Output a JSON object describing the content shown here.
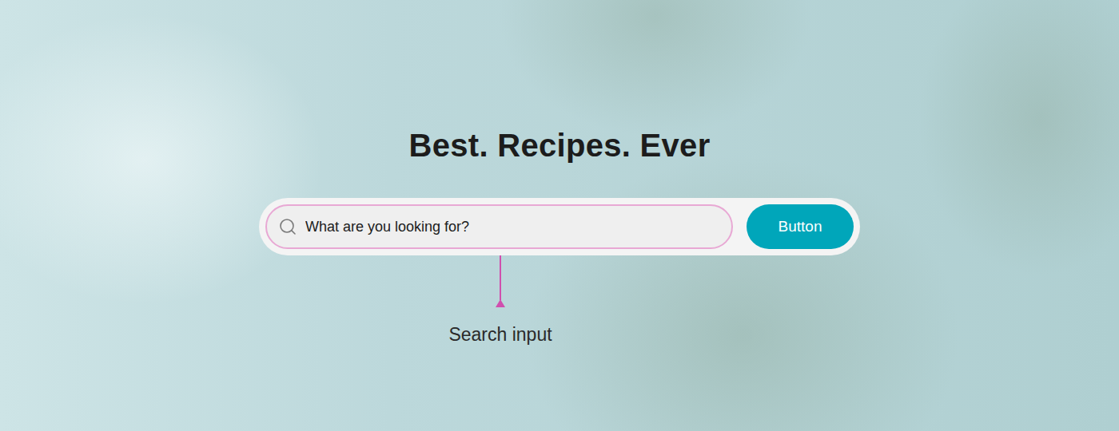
{
  "hero": {
    "title": "Best. Recipes. Ever"
  },
  "search": {
    "placeholder": "What are you looking for?",
    "button": "Button"
  },
  "annotation": {
    "label": "Search input"
  }
}
